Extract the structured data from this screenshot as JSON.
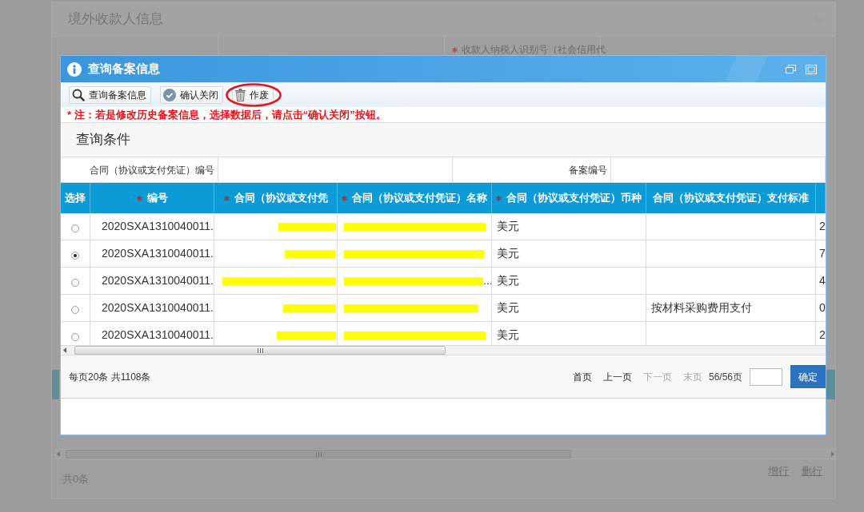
{
  "background": {
    "panel_title": "境外收款人信息",
    "field": {
      "label": "收款人纳税人识别号（社会信用代",
      "required": true
    },
    "footer": {
      "actions": [
        "增行",
        "删行"
      ],
      "summary": "共0条"
    }
  },
  "dialog": {
    "title": "查询备案信息",
    "toolbar": [
      {
        "label": "查询备案信息",
        "circled": false
      },
      {
        "label": "确认关闭",
        "circled": false
      },
      {
        "label": "作废",
        "circled": true
      }
    ],
    "note": "* 注：若是修改历史备案信息，选择数据后，请点击“确认关闭”按钮。",
    "query": {
      "title": "查询条件",
      "fields": [
        {
          "label": "合同（协议或支付凭证）编号"
        },
        {
          "label": "备案编号"
        }
      ]
    },
    "table": {
      "columns": [
        {
          "label": "选择",
          "required": false
        },
        {
          "label": "编号",
          "required": true
        },
        {
          "label": "合同（协议或支付凭",
          "required": true
        },
        {
          "label": "合同（协议或支付凭证）名称",
          "required": true
        },
        {
          "label": "合同（协议或支付凭证）币种",
          "required": true
        },
        {
          "label": "合同（协议或支付凭证）支付标准",
          "required": false
        }
      ],
      "rows": [
        {
          "selected": false,
          "number": "2020SXA1310040011.",
          "contract_no": {
            "redacted": true
          },
          "contract_name": {
            "redacted": true
          },
          "currency": "美元",
          "column_7": "2"
        },
        {
          "selected": true,
          "number": "2020SXA1310040011.",
          "contract_no": {
            "redacted": true
          },
          "contract_name": {
            "redacted": true
          },
          "currency": "美元",
          "column_7": "7"
        },
        {
          "selected": false,
          "number": "2020SXA1310040011.",
          "contract_no": {
            "redacted": true
          },
          "contract_name": {
            "redacted": true,
            "text": "..."
          },
          "currency": "美元",
          "column_7": "4"
        },
        {
          "selected": false,
          "number": "2020SXA1310040011.",
          "contract_no": {
            "redacted": true
          },
          "contract_name": {
            "redacted": true
          },
          "currency": "美元",
          "payment_standard": "按材料采购费用支付",
          "column_7": "0"
        },
        {
          "selected": false,
          "number": "2020SXA1310040011.",
          "contract_no": {
            "redacted": true
          },
          "contract_name": {
            "redacted": true
          },
          "currency": "美元",
          "column_7": "2"
        }
      ]
    },
    "pager": {
      "summary": "每页20条 共1108条",
      "links": [
        {
          "label": "首页",
          "disabled": false
        },
        {
          "label": "上一页",
          "disabled": false
        },
        {
          "label": "下一页",
          "disabled": true
        },
        {
          "label": "末页",
          "disabled": true
        }
      ],
      "page": "56/56页",
      "go_button": "确定"
    }
  }
}
